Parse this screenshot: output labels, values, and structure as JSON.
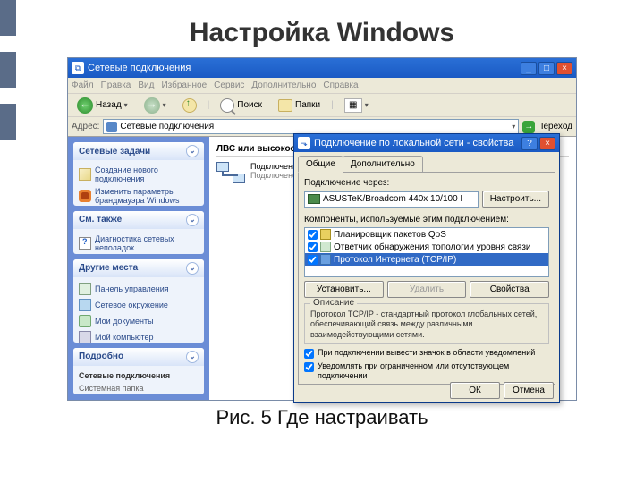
{
  "slide": {
    "title": "Настройка Windows",
    "caption": "Рис. 5 Где настраивать"
  },
  "window": {
    "title": "Сетевые подключения",
    "menus": [
      "Файл",
      "Правка",
      "Вид",
      "Избранное",
      "Сервис",
      "Дополнительно",
      "Справка"
    ],
    "toolbar": {
      "back": "Назад",
      "search": "Поиск",
      "folders": "Папки"
    },
    "address_label": "Адрес:",
    "address_value": "Сетевые подключения",
    "go": "Переход"
  },
  "sidebar": {
    "tasks": {
      "title": "Сетевые задачи",
      "items": [
        "Создание нового подключения",
        "Изменить параметры брандмауэра Windows"
      ]
    },
    "see_also": {
      "title": "См. также",
      "items": [
        "Диагностика сетевых неполадок"
      ]
    },
    "places": {
      "title": "Другие места",
      "items": [
        "Панель управления",
        "Сетевое окружение",
        "Мои документы",
        "Мой компьютер"
      ]
    },
    "details": {
      "title": "Подробно",
      "name": "Сетевые подключения",
      "type": "Системная папка"
    }
  },
  "content": {
    "category": "ЛВС или высокоскоростной Интернет",
    "conn": {
      "name": "Подключение по локальной сети",
      "status": "Подключено"
    }
  },
  "props": {
    "title": "Подключение по локальной сети - свойства",
    "tabs": [
      "Общие",
      "Дополнительно"
    ],
    "connect_via": "Подключение через:",
    "adapter": "ASUSTeK/Broadcom 440x 10/100 I",
    "configure": "Настроить...",
    "components_label": "Компоненты, используемые этим подключением:",
    "components": [
      {
        "name": "Планировщик пакетов QoS",
        "checked": true
      },
      {
        "name": "Ответчик обнаружения топологии уровня связи",
        "checked": true
      },
      {
        "name": "Протокол Интернета (TCP/IP)",
        "checked": true,
        "selected": true
      }
    ],
    "install": "Установить...",
    "uninstall": "Удалить",
    "properties": "Свойства",
    "desc_title": "Описание",
    "desc_text": "Протокол TCP/IP - стандартный протокол глобальных сетей, обеспечивающий связь между различными взаимодействующими сетями.",
    "notify": "При подключении вывести значок в области уведомлений",
    "limited": "Уведомлять при ограниченном или отсутствующем подключении",
    "ok": "ОК",
    "cancel": "Отмена"
  }
}
